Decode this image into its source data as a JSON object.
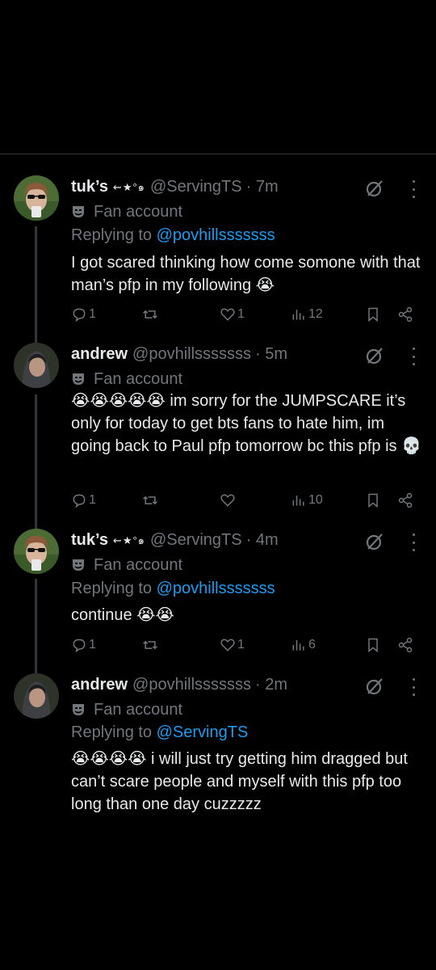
{
  "tweets": [
    {
      "name": "tuk’s",
      "name_decor": "⇜★°๑",
      "handle": "@ServingTS",
      "time": "· 7m",
      "badge": "Fan account",
      "reply_prefix": "Replying to ",
      "reply_to": "@povhillsssssss",
      "text": "I got scared thinking how come somone with that man’s pfp in my following 😭",
      "replies": "1",
      "reposts": "",
      "likes": "1",
      "views": "12"
    },
    {
      "name": "andrew",
      "name_decor": "",
      "handle": "@povhillsssssss",
      "time": "· 5m",
      "badge": "Fan account",
      "reply_prefix": "",
      "reply_to": "",
      "text": "😭😭😭😭😭 im sorry for the JUMPSCARE it’s only for today to get bts fans to hate him, im going back to Paul pfp tomorrow bc this pfp is 💀",
      "replies": "1",
      "reposts": "",
      "likes": "",
      "views": "10"
    },
    {
      "name": "tuk’s",
      "name_decor": "⇜★°๑",
      "handle": "@ServingTS",
      "time": "· 4m",
      "badge": "Fan account",
      "reply_prefix": "Replying to ",
      "reply_to": "@povhillsssssss",
      "text": "continue 😭😭",
      "replies": "1",
      "reposts": "",
      "likes": "1",
      "views": "6"
    },
    {
      "name": "andrew",
      "name_decor": "",
      "handle": "@povhillsssssss",
      "time": "· 2m",
      "badge": "Fan account",
      "reply_prefix": "Replying to ",
      "reply_to": "@ServingTS",
      "text": "😭😭😭😭 i will just try getting him dragged but can’t scare people and myself with this pfp too long than one day cuzzzzz",
      "replies": "",
      "reposts": "",
      "likes": "",
      "views": ""
    }
  ],
  "icons": {
    "reply": "reply-icon",
    "repost": "repost-icon",
    "like": "heart-icon",
    "views": "views-icon",
    "bookmark": "bookmark-icon",
    "share": "share-icon",
    "grok": "grok-icon",
    "more": "more-icon",
    "badge": "theater-mask-icon"
  },
  "colors": {
    "background": "#000000",
    "text": "#e7e9ea",
    "muted": "#71767b",
    "link": "#1d9bf0",
    "divider": "#2f3336"
  }
}
